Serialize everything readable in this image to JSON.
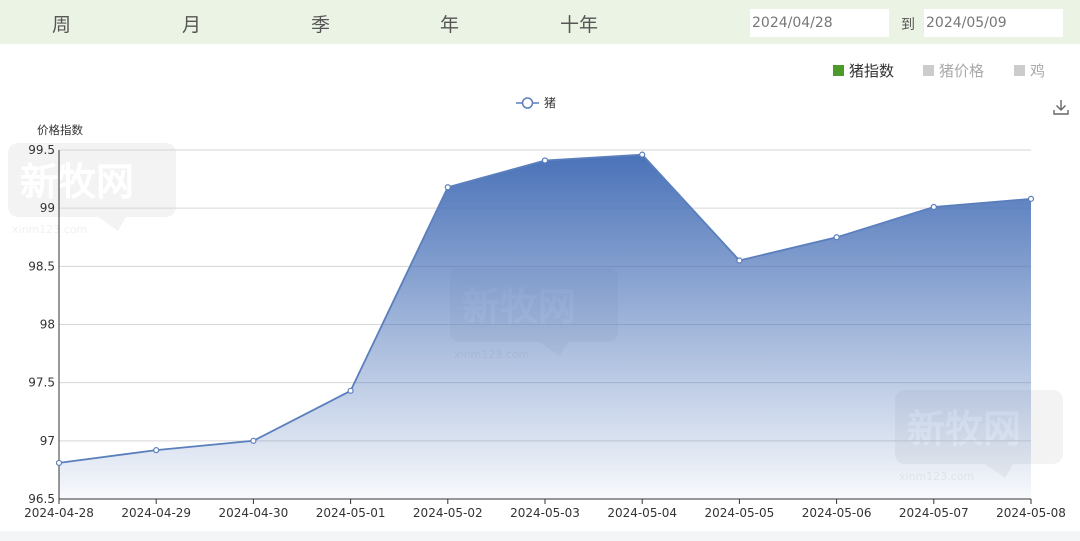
{
  "tabs": [
    {
      "label": "周"
    },
    {
      "label": "月"
    },
    {
      "label": "季"
    },
    {
      "label": "年"
    },
    {
      "label": "十年"
    }
  ],
  "date_range": {
    "start": "2024/04/28",
    "to_label": "到",
    "end": "2024/05/09"
  },
  "type_options": [
    {
      "label": "猪指数",
      "active": true,
      "color": "#4c9a2a"
    },
    {
      "label": "猪价格",
      "active": false,
      "color": "#cccccc"
    },
    {
      "label": "鸡",
      "active": false,
      "color": "#cccccc"
    }
  ],
  "download_icon": "download-icon",
  "watermark": {
    "logo": "新牧网",
    "site": "xinm123.com"
  },
  "chart_data": {
    "type": "area",
    "ylabel": "价格指数",
    "x": [
      "2024-04-28",
      "2024-04-29",
      "2024-04-30",
      "2024-05-01",
      "2024-05-02",
      "2024-05-03",
      "2024-05-04",
      "2024-05-05",
      "2024-05-06",
      "2024-05-07",
      "2024-05-08"
    ],
    "series": [
      {
        "name": "猪",
        "color": "#5b7fbd",
        "values": [
          96.81,
          96.92,
          97.0,
          97.43,
          99.18,
          99.41,
          99.46,
          98.55,
          98.75,
          99.01,
          99.08
        ]
      }
    ],
    "ylim": [
      96.5,
      99.5
    ],
    "yticks": [
      96.5,
      97,
      97.5,
      98,
      98.5,
      99,
      99.5
    ],
    "ytick_labels": [
      "96.5",
      "97",
      "97.5",
      "98",
      "98.5",
      "99",
      "99.5"
    ],
    "grid": true,
    "legend_position": "top-center"
  }
}
